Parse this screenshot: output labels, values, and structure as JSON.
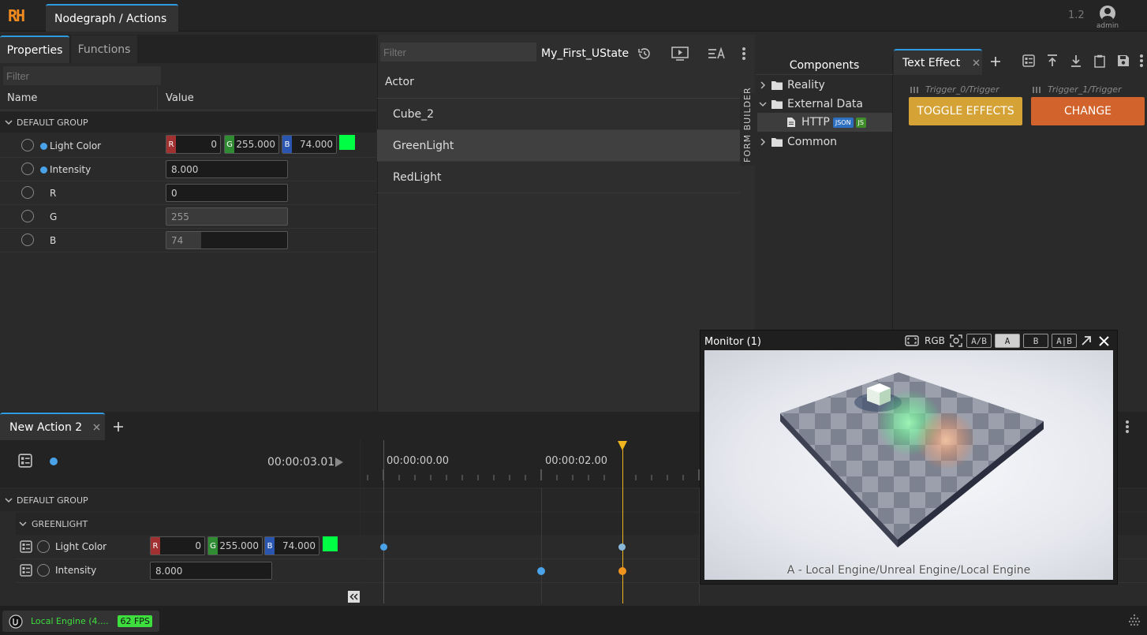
{
  "app": {
    "logo": "RH",
    "tab": "Nodegraph / Actions",
    "version": "1.2",
    "user": "admin"
  },
  "properties": {
    "tabs": [
      "Properties",
      "Functions"
    ],
    "filter_placeholder": "Filter",
    "col_name": "Name",
    "col_value": "Value",
    "group": "DEFAULT GROUP",
    "rows": {
      "light_color": {
        "label": "Light Color",
        "r_tag": "R",
        "r": "0",
        "g_tag": "G",
        "g": "255.000",
        "b_tag": "B",
        "b": "74.000",
        "swatch": "#00ff44"
      },
      "intensity": {
        "label": "Intensity",
        "value": "8.000"
      },
      "r": {
        "label": "R",
        "value": "0"
      },
      "g": {
        "label": "G",
        "value": "255"
      },
      "b": {
        "label": "B",
        "value": "74"
      }
    }
  },
  "center": {
    "filter_placeholder": "Filter",
    "ustate": "My_First_UState",
    "actor_header": "Actor",
    "actors": [
      "Cube_2",
      "GreenLight",
      "RedLight"
    ],
    "selected": "GreenLight",
    "form_builder": "FORM BUILDER"
  },
  "components": {
    "title": "Components",
    "tree": {
      "reality": "Reality",
      "external": "External Data",
      "http": "HTTP",
      "json": "JSON",
      "js": "JS",
      "common": "Common"
    }
  },
  "text_effect": {
    "tab": "Text Effect",
    "trigger0": "Trigger_0/Trigger",
    "trigger1": "Trigger_1/Trigger",
    "btn_toggle": "TOGGLE EFFECTS",
    "btn_change": "CHANGE",
    "toggle_color": "#d4a235",
    "change_color": "#d2632c"
  },
  "monitor": {
    "title": "Monitor (1)",
    "rgb": "RGB",
    "ab": "A/B",
    "a": "A",
    "b": "B",
    "aib": "A|B",
    "caption": "A - Local Engine/Unreal Engine/Local Engine"
  },
  "timeline": {
    "tab": "New Action 2",
    "time": "00:00:03.01",
    "tick0": "00:00:00.00",
    "tick2": "00:00:02.00",
    "group": "DEFAULT GROUP",
    "subgroup": "GREENLIGHT",
    "light_color": {
      "label": "Light Color",
      "r_tag": "R",
      "r": "0",
      "g_tag": "G",
      "g": "255.000",
      "b_tag": "B",
      "b": "74.000"
    },
    "intensity": {
      "label": "Intensity",
      "value": "8.000"
    }
  },
  "status": {
    "engine": "Local Engine (4....",
    "fps": "62 FPS"
  }
}
